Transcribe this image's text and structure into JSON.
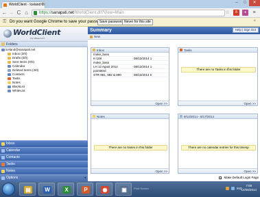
{
  "browser": {
    "tab_title": "WorldClient - Iceland Di",
    "address_https": "https://",
    "address_domain": "sanapati.net",
    "address_path": "/WorldClient.dll?View=Main",
    "infobar_message": "Do you want Google Chrome to save your password?",
    "save_password_label": "Save password",
    "never_label": "Never for this site",
    "close_glyph": "×",
    "back_glyph": "←",
    "forward_glyph": "→",
    "reload_glyph": "C",
    "home_glyph": "⌂",
    "star_glyph": "☆",
    "menu_glyph": "≡"
  },
  "app": {
    "logo_text": "WorldClient",
    "logo_sub": "For MDaemon®",
    "folders_label": "Folders",
    "tree": [
      {
        "label": "iceland@sanapati.net",
        "root": true,
        "icon_color": "#6b8bbf"
      },
      {
        "label": "Inbox (3/0)",
        "icon_color": "#e7b84a"
      },
      {
        "label": "Drafts (0/0)",
        "icon_color": "#e7b84a"
      },
      {
        "label": "Sent Items (0/0)",
        "icon_color": "#e7b84a"
      },
      {
        "label": "Calendar",
        "icon_color": "#6b8bbf"
      },
      {
        "label": "Deleted Items (4/0)",
        "icon_color": "#8aa0c2"
      },
      {
        "label": "Contacts",
        "icon_color": "#5c86c8"
      },
      {
        "label": "Tasks",
        "icon_color": "#d9662f"
      },
      {
        "label": "Notes",
        "icon_color": "#f0d264"
      },
      {
        "label": "BlackList",
        "icon_color": "#6b8bbf"
      },
      {
        "label": "WhiteList",
        "icon_color": "#6b8bbf"
      }
    ],
    "nav": [
      {
        "label": "Inbox",
        "icon_color": "#f0d264"
      },
      {
        "label": "Calendar",
        "icon_color": "#9fc0f0"
      },
      {
        "label": "Contacts",
        "icon_color": "#9fc0f0"
      },
      {
        "label": "Tasks",
        "icon_color": "#e87a3b"
      },
      {
        "label": "Notes",
        "icon_color": "#f0d264"
      },
      {
        "label": "Options",
        "icon_color": "#9fc0f0"
      }
    ],
    "summary_title": "Summary",
    "help_label": "Help | Sign Out",
    "new_label": "New",
    "inbox_panel": {
      "title": "Inbox",
      "rows": [
        {
          "subject": "moke_bass",
          "date": ""
        },
        {
          "subject": "K-108",
          "date": "08/12/2014 1"
        },
        {
          "subject": "moke_bass",
          "date": ""
        },
        {
          "subject": "LH 12 Agust 2014",
          "date": "08/12/2014 1"
        },
        {
          "subject": "pointeted",
          "date": ""
        },
        {
          "subject": "STR 981, 982 & 990",
          "date": "08/12/2014 0"
        }
      ],
      "open_label": "Open >>"
    },
    "tasks_panel": {
      "title": "Tasks",
      "empty": "There are no Tasks in this folder",
      "open_label": "Open >>"
    },
    "notes_panel": {
      "title": "Notes",
      "empty": "There are no Notes in this folder",
      "open_label": "Open >>"
    },
    "calendar_panel": {
      "title": "8/14/2014 - 8/17/2014",
      "empty": "There are no calendar entries for this timesp",
      "open_label": "Open >>"
    },
    "default_login_label": "Make Default Login Page",
    "default_login_checked": true
  },
  "taskbar": {
    "apps": [
      {
        "name": "explorer",
        "glyph": "▤",
        "color": "#d8a92f"
      },
      {
        "name": "word",
        "glyph": "W",
        "color": "#2b5fb0"
      },
      {
        "name": "excel",
        "glyph": "X",
        "color": "#2c8a3e"
      },
      {
        "name": "powerpoint",
        "glyph": "P",
        "color": "#d35a2a"
      },
      {
        "name": "chrome",
        "glyph": "◉",
        "color": "#d8452f"
      },
      {
        "name": "monitor",
        "glyph": "▣",
        "color": "#5b6f8c"
      }
    ],
    "hint": "Print Screen",
    "lang": "IND",
    "time": "7:59",
    "date": "14/08/2014"
  }
}
